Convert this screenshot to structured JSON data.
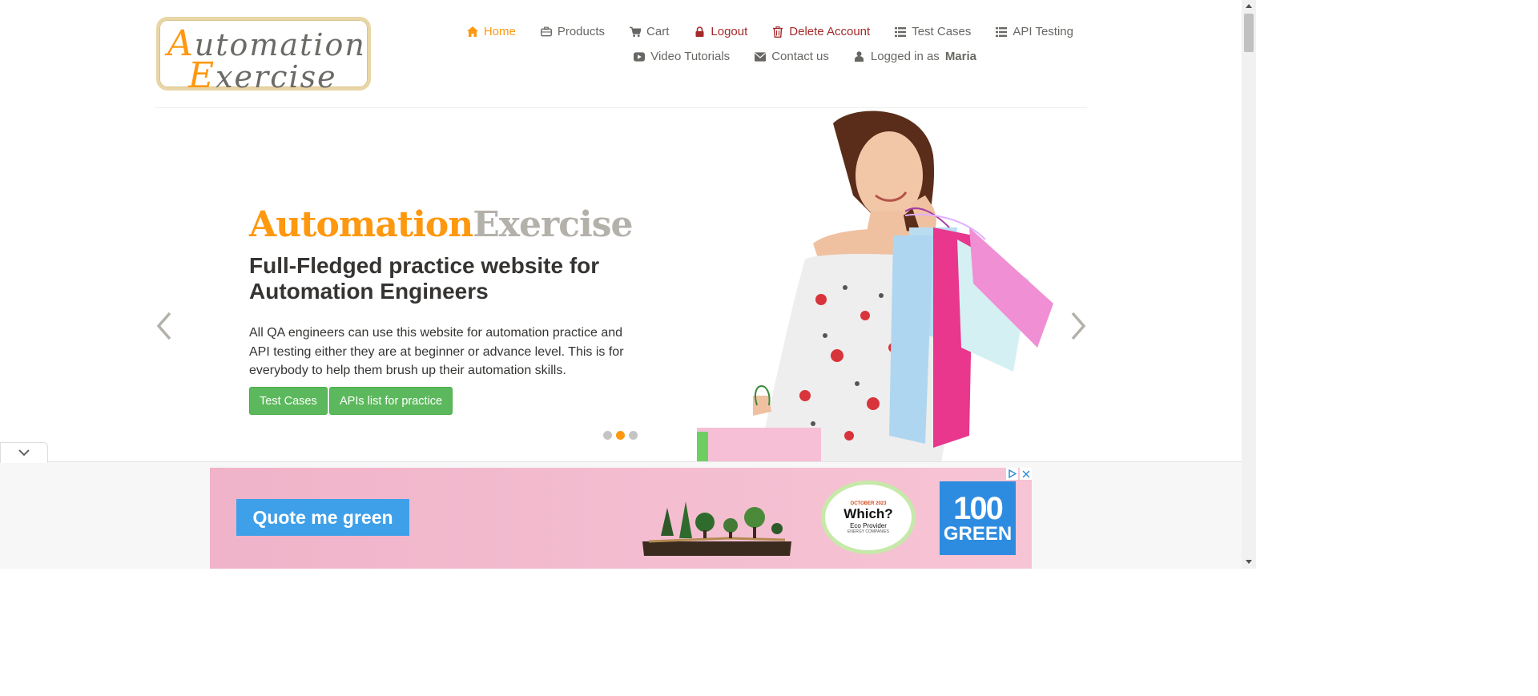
{
  "logo": {
    "line1_first": "A",
    "line1_rest": "utomation",
    "line2_first": "E",
    "line2_rest": "xercise"
  },
  "nav": {
    "row1": [
      {
        "label": "Home",
        "icon": "home-icon",
        "state": "active"
      },
      {
        "label": "Products",
        "icon": "briefcase-icon"
      },
      {
        "label": "Cart",
        "icon": "cart-icon"
      },
      {
        "label": "Logout",
        "icon": "lock-icon",
        "state": "danger"
      },
      {
        "label": "Delete Account",
        "icon": "trash-icon",
        "state": "danger"
      },
      {
        "label": "Test Cases",
        "icon": "list-icon"
      },
      {
        "label": "API Testing",
        "icon": "list-icon"
      }
    ],
    "row2": [
      {
        "label": "Video Tutorials",
        "icon": "youtube-play-icon"
      },
      {
        "label": "Contact us",
        "icon": "envelope-icon"
      },
      {
        "label": "Logged in as",
        "user": "Maria",
        "icon": "user-icon"
      }
    ]
  },
  "slider": {
    "title_part1": "Automation",
    "title_part2": "Exercise",
    "heading": "Full-Fledged practice website for Automation Engineers",
    "text": "All QA engineers can use this website for automation practice and API testing either they are at beginner or advance level. This is for everybody to help them brush up their automation skills.",
    "button1": "Test Cases",
    "button2": "APIs list for practice",
    "slide_count": 3,
    "active_slide": 2
  },
  "ad": {
    "cta": "Quote me green",
    "badge_line1": "OCTOBER 2023",
    "badge_line2": "Which?",
    "badge_line3": "Eco Provider",
    "badge_line4": "ENERGY COMPANIES",
    "green_number": "100",
    "green_word": "GREEN"
  },
  "colors": {
    "accent": "#fe980f",
    "danger": "#a52a2a",
    "button": "#5cb85c",
    "text": "#696763",
    "heading": "#363432"
  }
}
